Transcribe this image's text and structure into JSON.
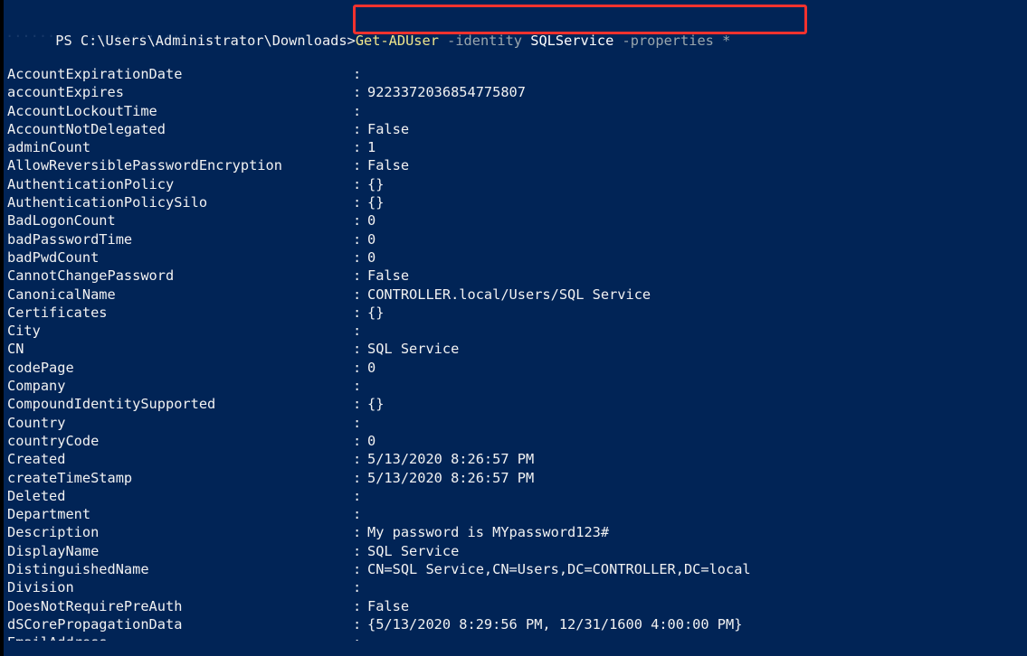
{
  "terminal": {
    "background_color": "#012456",
    "foreground_color": "#f2f2f2",
    "prompt": "PS C:\\Users\\Administrator\\Downloads>",
    "command": {
      "cmdlet": "Get-ADUser",
      "param1": " -identity",
      "value1": " SQLService",
      "param2": " -properties",
      "value2": " *",
      "full_text": "Get-ADUser -identity SQLService -properties *"
    },
    "annotation": {
      "type": "rectangle-highlight",
      "color": "#f4322e"
    },
    "ghost_line": "........ ............",
    "output": [
      {
        "name": "AccountExpirationDate",
        "value": ""
      },
      {
        "name": "accountExpires",
        "value": "9223372036854775807"
      },
      {
        "name": "AccountLockoutTime",
        "value": ""
      },
      {
        "name": "AccountNotDelegated",
        "value": "False"
      },
      {
        "name": "adminCount",
        "value": "1"
      },
      {
        "name": "AllowReversiblePasswordEncryption",
        "value": "False"
      },
      {
        "name": "AuthenticationPolicy",
        "value": "{}"
      },
      {
        "name": "AuthenticationPolicySilo",
        "value": "{}"
      },
      {
        "name": "BadLogonCount",
        "value": "0"
      },
      {
        "name": "badPasswordTime",
        "value": "0"
      },
      {
        "name": "badPwdCount",
        "value": "0"
      },
      {
        "name": "CannotChangePassword",
        "value": "False"
      },
      {
        "name": "CanonicalName",
        "value": "CONTROLLER.local/Users/SQL Service"
      },
      {
        "name": "Certificates",
        "value": "{}"
      },
      {
        "name": "City",
        "value": ""
      },
      {
        "name": "CN",
        "value": "SQL Service"
      },
      {
        "name": "codePage",
        "value": "0"
      },
      {
        "name": "Company",
        "value": ""
      },
      {
        "name": "CompoundIdentitySupported",
        "value": "{}"
      },
      {
        "name": "Country",
        "value": ""
      },
      {
        "name": "countryCode",
        "value": "0"
      },
      {
        "name": "Created",
        "value": "5/13/2020 8:26:57 PM"
      },
      {
        "name": "createTimeStamp",
        "value": "5/13/2020 8:26:57 PM"
      },
      {
        "name": "Deleted",
        "value": ""
      },
      {
        "name": "Department",
        "value": ""
      },
      {
        "name": "Description",
        "value": "My password is MYpassword123#"
      },
      {
        "name": "DisplayName",
        "value": "SQL Service"
      },
      {
        "name": "DistinguishedName",
        "value": "CN=SQL Service,CN=Users,DC=CONTROLLER,DC=local"
      },
      {
        "name": "Division",
        "value": ""
      },
      {
        "name": "DoesNotRequirePreAuth",
        "value": "False"
      },
      {
        "name": "dSCorePropagationData",
        "value": "{5/13/2020 8:29:56 PM, 12/31/1600 4:00:00 PM}"
      },
      {
        "name": "EmailAddress",
        "value": ""
      }
    ]
  }
}
